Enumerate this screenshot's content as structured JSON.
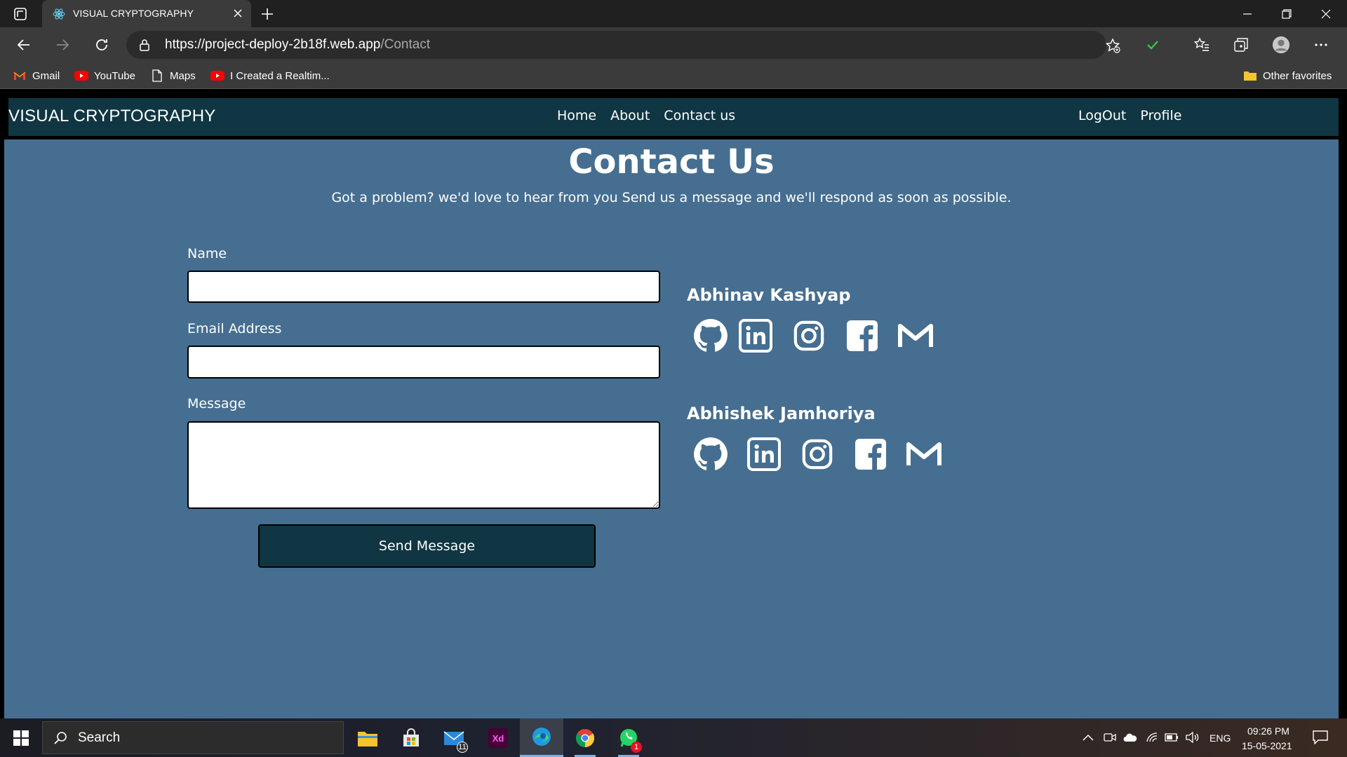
{
  "browser": {
    "tab_title": "VISUAL CRYPTOGRAPHY",
    "url_host": "https://project-deploy-2b18f.web.app",
    "url_path": "/Contact",
    "bookmarks": [
      {
        "label": "Gmail",
        "icon": "gmail-icon"
      },
      {
        "label": "YouTube",
        "icon": "youtube-icon"
      },
      {
        "label": "Maps",
        "icon": "page-icon"
      },
      {
        "label": "I Created a Realtim...",
        "icon": "youtube-icon"
      }
    ],
    "other_favorites": "Other favorites"
  },
  "navbar": {
    "brand": "VISUAL CRYPTOGRAPHY",
    "links": [
      "Home",
      "About",
      "Contact us"
    ],
    "right_links": [
      "LogOut",
      "Profile"
    ],
    "background": "#0f3642"
  },
  "contact": {
    "title": "Contact Us",
    "subtitle": "Got a problem? we'd love to hear from you Send us a message and we'll respond as soon as possible.",
    "name_label": "Name",
    "name_value": "",
    "email_label": "Email Address",
    "email_value": "",
    "message_label": "Message",
    "message_value": "",
    "send_label": "Send Message",
    "background": "#456e91"
  },
  "people": [
    {
      "name": "Abhinav Kashyap",
      "socials": [
        "github-icon",
        "linkedin-icon",
        "instagram-icon",
        "facebook-icon",
        "gmail-icon"
      ]
    },
    {
      "name": "Abhishek Jamhoriya",
      "socials": [
        "github-icon",
        "linkedin-icon",
        "instagram-icon",
        "facebook-icon",
        "gmail-icon"
      ]
    }
  ],
  "taskbar": {
    "search_placeholder": "Search",
    "mail_badge": "11",
    "whatsapp_badge": "1",
    "language": "ENG",
    "time": "09:26 PM",
    "date": "15-05-2021"
  }
}
